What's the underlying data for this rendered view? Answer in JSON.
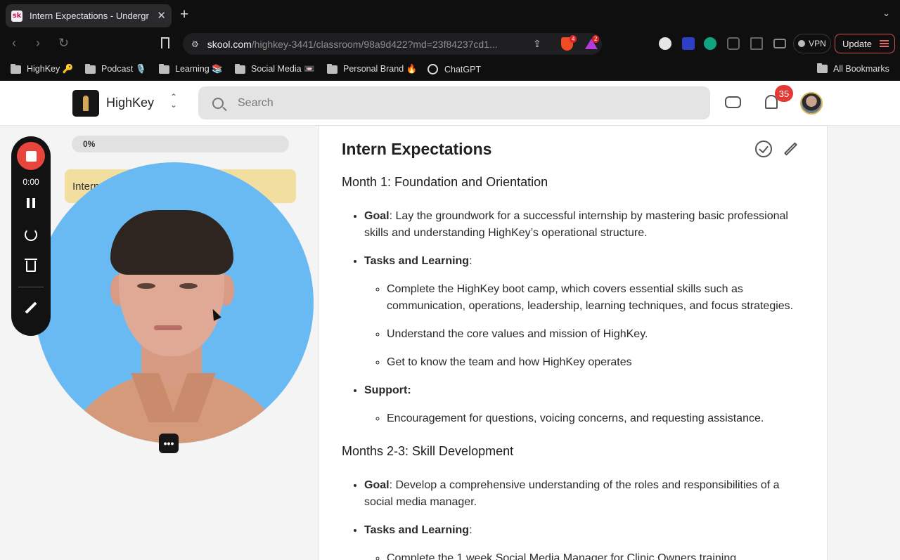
{
  "browser": {
    "tab_title": "Intern Expectations - Undergr",
    "tab_favicon": "sk",
    "url_host": "skool.com",
    "url_path": "/highkey-3441/classroom/98a9d422?md=23f84237cd1...",
    "brave_badge": "4",
    "alert_badge": "2",
    "vpn_label": "VPN",
    "update_label": "Update",
    "bookmarks": [
      {
        "label": "HighKey 🔑"
      },
      {
        "label": "Podcast 🎙️"
      },
      {
        "label": "Learning 📚"
      },
      {
        "label": "Social Media 📼"
      },
      {
        "label": "Personal Brand 🔥"
      },
      {
        "label": "ChatGPT"
      }
    ],
    "all_bookmarks": "All Bookmarks"
  },
  "header": {
    "brand": "HighKey",
    "search_placeholder": "Search",
    "notification_count": "35"
  },
  "sidebar": {
    "progress_label": "0%",
    "progress": 0,
    "lesson_label": "Intern Expectations"
  },
  "recorder": {
    "time": "0:00"
  },
  "lesson": {
    "title": "Intern Expectations",
    "month1": {
      "heading": "Month 1: Foundation and Orientation",
      "goal_label": "Goal",
      "goal_text": ": Lay the groundwork for a successful internship by mastering basic professional skills and understanding HighKey’s operational structure.",
      "tasks_label": "Tasks and Learning",
      "tasks_suffix": ":",
      "tasks": [
        "Complete the HighKey boot camp, which covers essential skills such as communication, operations, leadership, learning techniques, and focus strategies.",
        "Understand the core values and mission of HighKey.",
        "Get to know the team and how HighKey operates"
      ],
      "support_label": "Support:",
      "support": [
        "Encouragement for questions, voicing concerns, and requesting assistance."
      ]
    },
    "month23": {
      "heading": "Months 2-3: Skill Development",
      "goal_label": "Goal",
      "goal_text": ": Develop a comprehensive understanding of the roles and responsibilities of a social media manager.",
      "tasks_label": "Tasks and Learning",
      "tasks_suffix": ":",
      "tasks_partial": "Complete the 1 week Social Media Manager for Clinic Owners training"
    }
  },
  "colors": {
    "accent_gold": "#d6b24c",
    "lesson_highlight": "#f2df9f",
    "badge_red": "#e53935",
    "webcam_bg": "#69b9f2",
    "record_red": "#e8453c"
  }
}
